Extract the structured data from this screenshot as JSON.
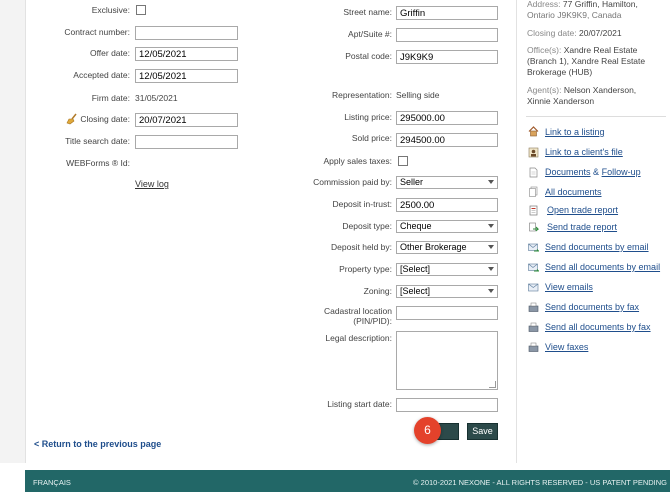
{
  "left_form": {
    "exclusive_label": "Exclusive:",
    "contract_number_label": "Contract number:",
    "contract_number_value": "",
    "offer_date_label": "Offer date:",
    "offer_date_value": "12/05/2021",
    "accepted_date_label": "Accepted date:",
    "accepted_date_value": "12/05/2021",
    "firm_date_label": "Firm date:",
    "firm_date_value": "31/05/2021",
    "closing_date_label": "Closing date:",
    "closing_date_value": "20/07/2021",
    "title_search_label": "Title search date:",
    "title_search_value": "",
    "webforms_label": "WEBForms ® Id:",
    "view_log": "View log"
  },
  "right_form": {
    "street_name_label": "Street name:",
    "street_name_value": "Griffin",
    "apt_label": "Apt/Suite #:",
    "apt_value": "",
    "postal_code_label": "Postal code:",
    "postal_code_value": "J9K9K9",
    "representation_label": "Representation:",
    "representation_value": "Selling side",
    "listing_price_label": "Listing price:",
    "listing_price_value": "295000.00",
    "sold_price_label": "Sold price:",
    "sold_price_value": "294500.00",
    "sales_taxes_label": "Apply sales taxes:",
    "commission_label": "Commission paid by:",
    "commission_value": "Seller",
    "deposit_trust_label": "Deposit in-trust:",
    "deposit_trust_value": "2500.00",
    "deposit_type_label": "Deposit type:",
    "deposit_type_value": "Cheque",
    "deposit_held_label": "Deposit held by:",
    "deposit_held_value": "Other Brokerage",
    "property_type_label": "Property type:",
    "property_type_value": "[Select]",
    "zoning_label": "Zoning:",
    "zoning_value": "[Select]",
    "cadastral_label_1": "Cadastral location",
    "cadastral_label_2": "(PIN/PID):",
    "cadastral_value": "",
    "legal_label": "Legal description:",
    "listing_start_label": "Listing start date:",
    "listing_start_value": ""
  },
  "buttons": {
    "save": "Save",
    "back": "< Return to the previous page",
    "step_badge": "6"
  },
  "info": {
    "address_label": "Address:",
    "address_line1": "77 Griffin, Hamilton,",
    "address_line2": "Ontario J9K9K9, Canada",
    "closing_label": "Closing date:",
    "closing_value": "20/07/2021",
    "office_label": "Office(s):",
    "office_line1": "Xandre Real Estate",
    "office_line2": "(Branch 1), Xandre Real Estate",
    "office_line3": "Brokerage (HUB)",
    "agent_label": "Agent(s):",
    "agent_line1": "Nelson Xanderson,",
    "agent_line2": "Xinnie Xanderson"
  },
  "sidebar_links": [
    {
      "label": "Link to a listing",
      "icon": "house-icon"
    },
    {
      "label": "Link to a client's file",
      "icon": "person-file-icon"
    },
    {
      "label_a": "Documents",
      "label_b": "&",
      "label_c": "Follow-up",
      "icon": "document-icon"
    },
    {
      "label": "All documents",
      "icon": "documents-icon"
    },
    {
      "label": "Open trade report",
      "icon": "report-icon"
    },
    {
      "label": "Send trade report",
      "icon": "send-report-icon"
    },
    {
      "label": "Send documents by email",
      "icon": "email-send-icon"
    },
    {
      "label": "Send all documents by email",
      "icon": "email-send-all-icon"
    },
    {
      "label": "View emails",
      "icon": "email-view-icon"
    },
    {
      "label": "Send documents by fax",
      "icon": "fax-icon"
    },
    {
      "label": "Send all documents by fax",
      "icon": "fax-all-icon"
    },
    {
      "label": "View faxes",
      "icon": "fax-view-icon"
    }
  ],
  "footer": {
    "language": "FRANÇAIS",
    "copyright": "© 2010-2021 NEXONE - ALL RIGHTS RESERVED - US PATENT PENDING"
  },
  "colors": {
    "footer_bg": "#226767",
    "link": "#1f4e8c",
    "save_button": "#2c4a4a",
    "badge": "#e4422b"
  }
}
